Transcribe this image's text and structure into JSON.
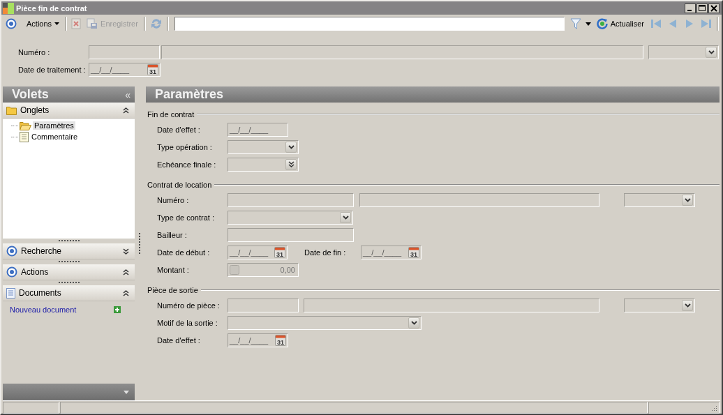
{
  "window": {
    "title": "Pièce fin de contrat"
  },
  "toolbar": {
    "items": [
      {
        "kind": "app-menu"
      },
      {
        "kind": "menu",
        "label": "Actions"
      },
      {
        "kind": "separator"
      },
      {
        "kind": "delete",
        "disabled": true
      },
      {
        "kind": "save",
        "label": "Enregistrer",
        "disabled": true
      },
      {
        "kind": "separator"
      },
      {
        "kind": "refresh",
        "disabled": true
      },
      {
        "kind": "separator"
      },
      {
        "kind": "search"
      },
      {
        "kind": "filter"
      },
      {
        "kind": "dropdown"
      },
      {
        "kind": "reload",
        "label": "Actualiser"
      },
      {
        "kind": "first",
        "disabled": true
      },
      {
        "kind": "previous",
        "disabled": true
      },
      {
        "kind": "next",
        "disabled": true
      },
      {
        "kind": "last",
        "disabled": true
      },
      {
        "kind": "separator"
      }
    ]
  },
  "header": {
    "rows": [
      {
        "label": "Numéro :",
        "fields": [
          {
            "kind": "text"
          },
          {
            "kind": "text"
          },
          {
            "kind": "select"
          }
        ]
      },
      {
        "label": "Date de traitement :",
        "fields": [
          {
            "kind": "date",
            "value": "__/__/____",
            "calendar": "31"
          }
        ]
      }
    ]
  },
  "sidebar": {
    "title": "Volets",
    "collapse": "«",
    "sections": [
      {
        "kind": "tabs",
        "title": "Onglets",
        "expanded": true,
        "children": [
          {
            "kind": "folder",
            "label": "Paramètres",
            "selected": true
          },
          {
            "kind": "page",
            "label": "Commentaire",
            "selected": false
          }
        ]
      },
      {
        "kind": "actions",
        "title": "Recherche",
        "expanded": false
      },
      {
        "kind": "actions",
        "title": "Actions",
        "expanded": true
      },
      {
        "kind": "documents",
        "title": "Documents",
        "expanded": true,
        "links": [
          {
            "label": "Nouveau document"
          }
        ]
      }
    ]
  },
  "panel": {
    "title": "Paramètres",
    "groups": [
      {
        "title": "Fin de contrat",
        "rows": [
          {
            "label": "Date d'effet :",
            "fields": [
              {
                "kind": "date",
                "value": "__/__/____"
              }
            ]
          },
          {
            "label": "Type opération :",
            "fields": [
              {
                "kind": "select"
              }
            ]
          },
          {
            "label": "Echéance finale :",
            "fields": [
              {
                "kind": "select-double"
              }
            ]
          }
        ]
      },
      {
        "title": "Contrat de location",
        "rows": [
          {
            "label": "Numéro :",
            "fields": [
              {
                "kind": "text"
              },
              {
                "kind": "text"
              },
              {
                "kind": "select"
              }
            ]
          },
          {
            "label": "Type de contrat :",
            "fields": [
              {
                "kind": "select"
              }
            ]
          },
          {
            "label": "Bailleur :",
            "fields": [
              {
                "kind": "text"
              }
            ]
          },
          {
            "label": "Date de début :",
            "fields": [
              {
                "kind": "date",
                "value": "__/__/____",
                "calendar": "31"
              },
              {
                "kind": "label",
                "text": "Date de fin :"
              },
              {
                "kind": "date",
                "value": "__/__/____",
                "calendar": "31"
              }
            ]
          },
          {
            "label": "Montant :",
            "fields": [
              {
                "kind": "amount",
                "value": "0,00"
              }
            ]
          }
        ]
      },
      {
        "title": "Pièce de sortie",
        "rows": [
          {
            "label": "Numéro de pièce :",
            "fields": [
              {
                "kind": "text"
              },
              {
                "kind": "text"
              },
              {
                "kind": "select"
              }
            ]
          },
          {
            "label": "Motif de la sortie :",
            "fields": [
              {
                "kind": "select"
              }
            ]
          },
          {
            "label": "Date d'effet :",
            "fields": [
              {
                "kind": "date",
                "value": "__/__/____",
                "calendar": "31"
              }
            ]
          }
        ]
      }
    ]
  }
}
